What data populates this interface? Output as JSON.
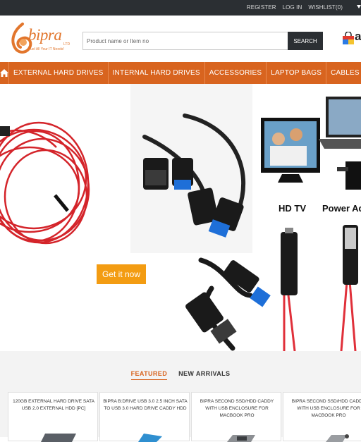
{
  "topbar": {
    "links": [
      "REGISTER",
      "LOG IN",
      "WISHLIST(0)"
    ]
  },
  "header": {
    "logo_name": "bipra",
    "logo_tm": "LTD",
    "logo_tagline": "Fuel All Your IT Needs!",
    "search_placeholder": "Product name or Item no",
    "search_button": "SEARCH",
    "cart_letter": "a"
  },
  "nav": {
    "home_icon": "home-icon",
    "items": [
      "EXTERNAL HARD DRIVES",
      "INTERNAL HARD DRIVES",
      "ACCESSORIES",
      "LAPTOP BAGS",
      "CABLES"
    ]
  },
  "banner": {
    "cta": "Get it now",
    "label_hdtv": "HD TV",
    "label_power": "Power Ada"
  },
  "products": {
    "tabs": [
      "FEATURED",
      "NEW ARRIVALS"
    ],
    "active_tab": "FEATURED",
    "cards": [
      {
        "title": "120GB EXTERNAL HARD DRIVE SATA USB 2.0 EXTERNAL HDD [PC]"
      },
      {
        "title": "BIPRA B:DRIVE USB 3.0 2.5 INCH SATA TO USB 3.0 HARD DRIVE CADDY HDD"
      },
      {
        "title": "BIPRA SECOND SSD/HDD CADDY WITH USB ENCLOSURE FOR MACBOOK PRO"
      },
      {
        "title": "BIPRA SECOND SSD/HDD CADDY WITH USB ENCLOSURE FOR MACBOOK PRO"
      }
    ]
  },
  "colors": {
    "accent": "#d8641f",
    "topbar": "#2b2f33",
    "cta": "#f39c12"
  }
}
